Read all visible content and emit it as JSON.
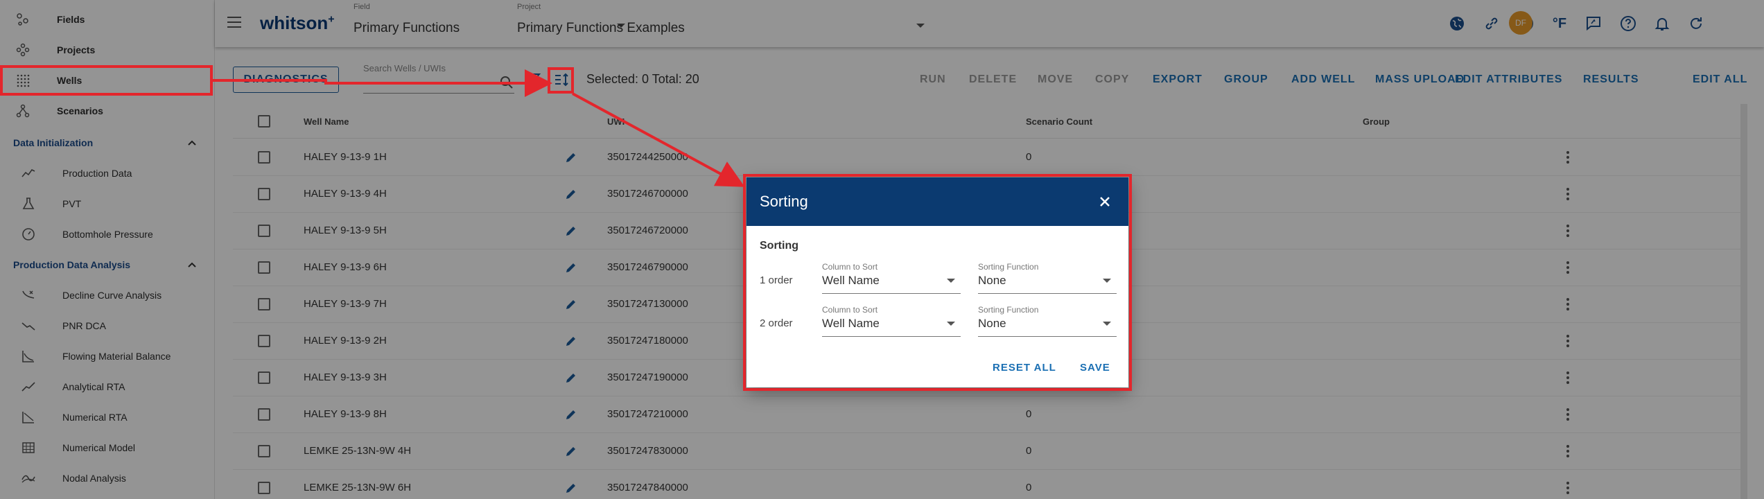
{
  "sidebar": {
    "top_items": [
      {
        "label": "Fields",
        "icon": "fields-icon"
      },
      {
        "label": "Projects",
        "icon": "projects-icon"
      },
      {
        "label": "Wells",
        "icon": "wells-icon"
      },
      {
        "label": "Scenarios",
        "icon": "scenarios-icon"
      }
    ],
    "sections": [
      {
        "label": "Data Initialization",
        "items": [
          {
            "label": "Production Data",
            "icon": "production-data-icon"
          },
          {
            "label": "PVT",
            "icon": "pvt-flask-icon"
          },
          {
            "label": "Bottomhole Pressure",
            "icon": "gauge-icon"
          }
        ]
      },
      {
        "label": "Production Data Analysis",
        "items": [
          {
            "label": "Decline Curve Analysis",
            "icon": "decline-curve-icon"
          },
          {
            "label": "PNR DCA",
            "icon": "pnr-dca-icon"
          },
          {
            "label": "Flowing Material Balance",
            "icon": "fmb-chart-icon"
          },
          {
            "label": "Analytical RTA",
            "icon": "analytical-rta-icon"
          },
          {
            "label": "Numerical RTA",
            "icon": "numerical-rta-icon"
          },
          {
            "label": "Numerical Model",
            "icon": "numerical-model-icon"
          },
          {
            "label": "Nodal Analysis",
            "icon": "nodal-analysis-icon"
          }
        ]
      }
    ]
  },
  "header": {
    "logo": "whitson",
    "logo_sup": "+",
    "field_caption": "Field",
    "field_value": "Primary Functions",
    "project_caption": "Project",
    "project_value": "Primary Functions Examples",
    "icons": [
      "globe-icon",
      "link-icon",
      "download-circle-icon",
      "fahrenheit-icon",
      "feedback-icon",
      "help-icon",
      "bell-icon",
      "refresh-icon"
    ],
    "fahrenheit_label": "°F",
    "avatar_initials": "DF"
  },
  "toolbar": {
    "diagnostics_label": "DIAGNOSTICS",
    "search_placeholder": "Search Wells / UWIs",
    "selected_total": "Selected: 0 Total: 20",
    "actions": [
      {
        "label": "RUN",
        "enabled": false
      },
      {
        "label": "DELETE",
        "enabled": false
      },
      {
        "label": "MOVE",
        "enabled": false
      },
      {
        "label": "COPY",
        "enabled": false
      },
      {
        "label": "EXPORT",
        "enabled": true
      },
      {
        "label": "GROUP",
        "enabled": true
      },
      {
        "label": "ADD WELL",
        "enabled": true
      },
      {
        "label": "MASS UPLOAD",
        "enabled": true
      },
      {
        "label": "EDIT ATTRIBUTES",
        "enabled": true
      },
      {
        "label": "RESULTS",
        "enabled": true
      },
      {
        "label": "EDIT ALL",
        "enabled": true
      }
    ]
  },
  "table": {
    "columns": [
      "Well Name",
      "UWI",
      "Scenario Count",
      "Group"
    ],
    "rows": [
      {
        "name": "HALEY 9-13-9 1H",
        "uwi": "35017244250000",
        "scenarios": "0"
      },
      {
        "name": "HALEY 9-13-9 4H",
        "uwi": "35017246700000",
        "scenarios": ""
      },
      {
        "name": "HALEY 9-13-9 5H",
        "uwi": "35017246720000",
        "scenarios": ""
      },
      {
        "name": "HALEY 9-13-9 6H",
        "uwi": "35017246790000",
        "scenarios": ""
      },
      {
        "name": "HALEY 9-13-9 7H",
        "uwi": "35017247130000",
        "scenarios": ""
      },
      {
        "name": "HALEY 9-13-9 2H",
        "uwi": "35017247180000",
        "scenarios": ""
      },
      {
        "name": "HALEY 9-13-9 3H",
        "uwi": "35017247190000",
        "scenarios": ""
      },
      {
        "name": "HALEY 9-13-9 8H",
        "uwi": "35017247210000",
        "scenarios": "0"
      },
      {
        "name": "LEMKE 25-13N-9W 4H",
        "uwi": "35017247830000",
        "scenarios": "0"
      },
      {
        "name": "LEMKE 25-13N-9W 6H",
        "uwi": "35017247840000",
        "scenarios": "0"
      }
    ]
  },
  "dialog": {
    "title": "Sorting",
    "subtitle": "Sorting",
    "orders": [
      {
        "label": "1 order",
        "column_caption": "Column to Sort",
        "column_value": "Well Name",
        "function_caption": "Sorting Function",
        "function_value": "None"
      },
      {
        "label": "2 order",
        "column_caption": "Column to Sort",
        "column_value": "Well Name",
        "function_caption": "Sorting Function",
        "function_value": "None"
      }
    ],
    "reset_label": "RESET ALL",
    "save_label": "SAVE"
  },
  "colors": {
    "brand": "#0b3a70",
    "accent": "#1a6fb3",
    "highlight": "#e3262c",
    "disabled": "#9a9a9a"
  }
}
